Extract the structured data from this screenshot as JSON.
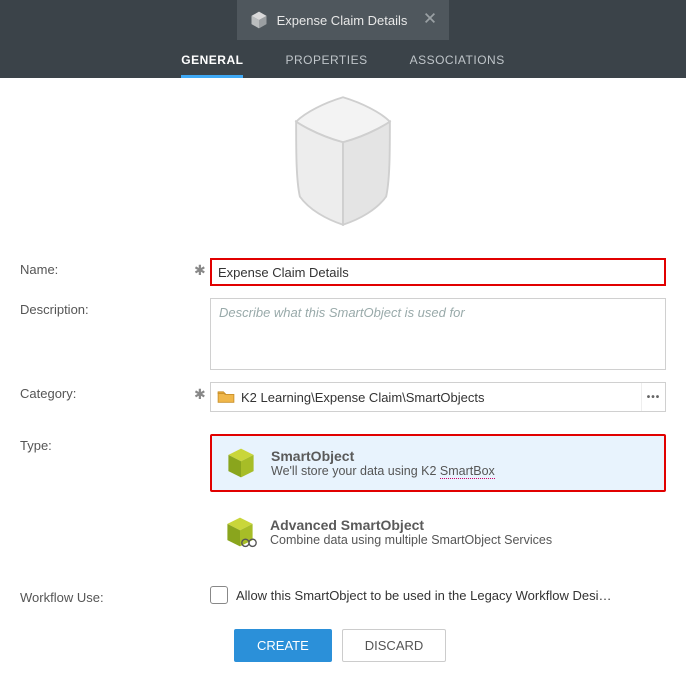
{
  "window": {
    "title": "Expense Claim Details"
  },
  "tabs": {
    "general": "GENERAL",
    "properties": "PROPERTIES",
    "associations": "ASSOCIATIONS"
  },
  "form": {
    "name_label": "Name:",
    "name_value": "Expense Claim Details",
    "description_label": "Description:",
    "description_placeholder": "Describe what this SmartObject is used for",
    "category_label": "Category:",
    "category_value": "K2 Learning\\Expense Claim\\SmartObjects",
    "type_label": "Type:",
    "type_smartobject_title": "SmartObject",
    "type_smartobject_sub_prefix": "We'll store your data using K2 ",
    "type_smartobject_sub_link": "SmartBox",
    "type_advanced_title": "Advanced SmartObject",
    "type_advanced_sub": "Combine data using multiple SmartObject Services",
    "workflow_label": "Workflow Use:",
    "workflow_checkbox_label": "Allow this SmartObject to be used in the Legacy Workflow Desi…"
  },
  "buttons": {
    "create": "CREATE",
    "discard": "DISCARD"
  }
}
